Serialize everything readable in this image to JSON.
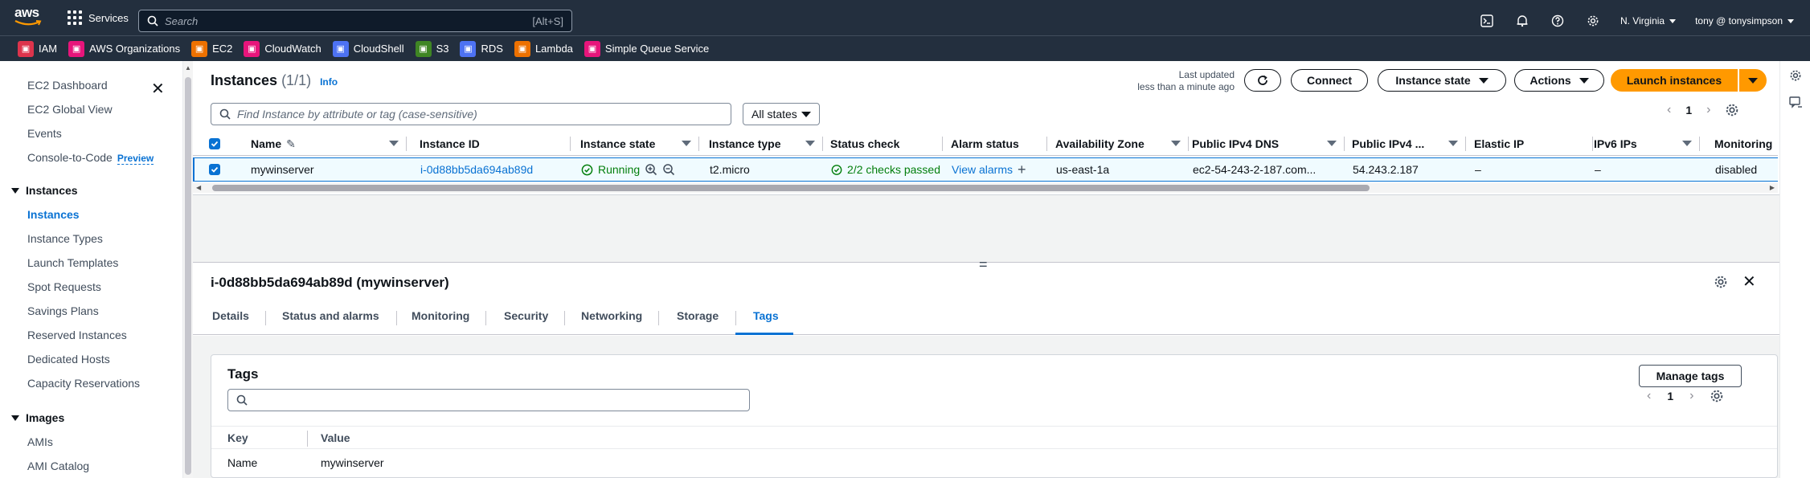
{
  "topnav": {
    "logo": "aws",
    "services_label": "Services",
    "search_placeholder": "Search",
    "search_shortcut": "[Alt+S]",
    "region": "N. Virginia",
    "account": "tony @ tonysimpson"
  },
  "favorites": [
    {
      "label": "IAM",
      "color": "#dd344c",
      "icon": "iam-icon"
    },
    {
      "label": "AWS Organizations",
      "color": "#e7157b",
      "icon": "organizations-icon"
    },
    {
      "label": "EC2",
      "color": "#ed7100",
      "icon": "ec2-icon"
    },
    {
      "label": "CloudWatch",
      "color": "#e7157b",
      "icon": "cloudwatch-icon"
    },
    {
      "label": "CloudShell",
      "color": "#4d72f3",
      "icon": "cloudshell-icon"
    },
    {
      "label": "S3",
      "color": "#3f8624",
      "icon": "s3-icon"
    },
    {
      "label": "RDS",
      "color": "#4d72f3",
      "icon": "rds-icon"
    },
    {
      "label": "Lambda",
      "color": "#ed7100",
      "icon": "lambda-icon"
    },
    {
      "label": "Simple Queue Service",
      "color": "#e7157b",
      "icon": "sqs-icon"
    }
  ],
  "sidebar": {
    "items": [
      {
        "label": "EC2 Dashboard"
      },
      {
        "label": "EC2 Global View"
      },
      {
        "label": "Events"
      },
      {
        "label": "Console-to-Code",
        "badge": "Preview"
      },
      {
        "label": "Instances",
        "section": true
      },
      {
        "label": "Instances",
        "active": true
      },
      {
        "label": "Instance Types"
      },
      {
        "label": "Launch Templates"
      },
      {
        "label": "Spot Requests"
      },
      {
        "label": "Savings Plans"
      },
      {
        "label": "Reserved Instances"
      },
      {
        "label": "Dedicated Hosts"
      },
      {
        "label": "Capacity Reservations"
      },
      {
        "label": "Images",
        "section": true
      },
      {
        "label": "AMIs"
      },
      {
        "label": "AMI Catalog"
      }
    ]
  },
  "instances": {
    "title": "Instances",
    "count": "(1/1)",
    "info": "Info",
    "last_updated_label": "Last updated",
    "last_updated_value": "less than a minute ago",
    "connect": "Connect",
    "instance_state": "Instance state",
    "actions": "Actions",
    "launch": "Launch instances",
    "filter_placeholder": "Find Instance by attribute or tag (case-sensitive)",
    "states_select": "All states",
    "page": "1",
    "columns": [
      "Name",
      "Instance ID",
      "Instance state",
      "Instance type",
      "Status check",
      "Alarm status",
      "Availability Zone",
      "Public IPv4 DNS",
      "Public IPv4 ...",
      "Elastic IP",
      "IPv6 IPs",
      "Monitoring"
    ],
    "row": {
      "name": "mywinserver",
      "instance_id": "i-0d88bb5da694ab89d",
      "state": "Running",
      "type": "t2.micro",
      "status_check": "2/2 checks passed",
      "alarm": "View alarms",
      "az": "us-east-1a",
      "dns": "ec2-54-243-2-187.com...",
      "ipv4": "54.243.2.187",
      "elastic_ip": "–",
      "ipv6": "–",
      "monitoring": "disabled"
    }
  },
  "details": {
    "title": "i-0d88bb5da694ab89d (mywinserver)",
    "tabs": [
      "Details",
      "Status and alarms",
      "Monitoring",
      "Security",
      "Networking",
      "Storage",
      "Tags"
    ],
    "active_tab": "Tags"
  },
  "tags": {
    "title": "Tags",
    "manage": "Manage tags",
    "page": "1",
    "col_key": "Key",
    "col_value": "Value",
    "rows": [
      {
        "key": "Name",
        "value": "mywinserver"
      }
    ]
  }
}
